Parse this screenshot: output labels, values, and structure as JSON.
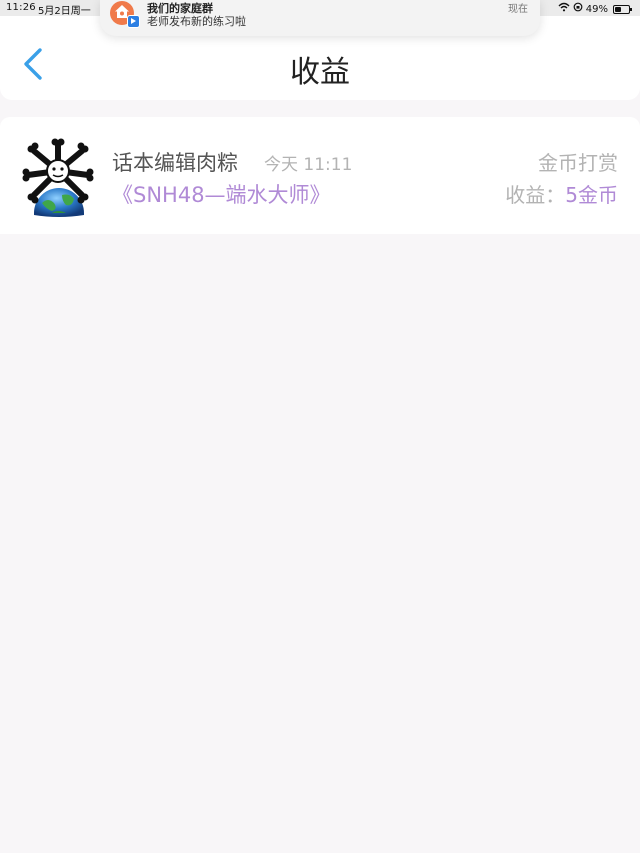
{
  "status_bar": {
    "time": "11:26",
    "date": "5月2日周一",
    "battery": "49%"
  },
  "notification": {
    "title": "我们的家庭群",
    "body": "老师发布新的练习啦",
    "time": "现在"
  },
  "nav": {
    "title": "收益"
  },
  "items": [
    {
      "user": "话本编辑肉粽",
      "time": "今天 11:11",
      "work_title": "《SNH48—端水大师》",
      "type": "金币打赏",
      "earnings_label": "收益：",
      "earnings_value": "5金币"
    }
  ],
  "colors": {
    "accent": "#3aa0e8",
    "purple": "#b08ad6",
    "gray_text": "#b3b3b3",
    "background": "#f8f6f8"
  }
}
